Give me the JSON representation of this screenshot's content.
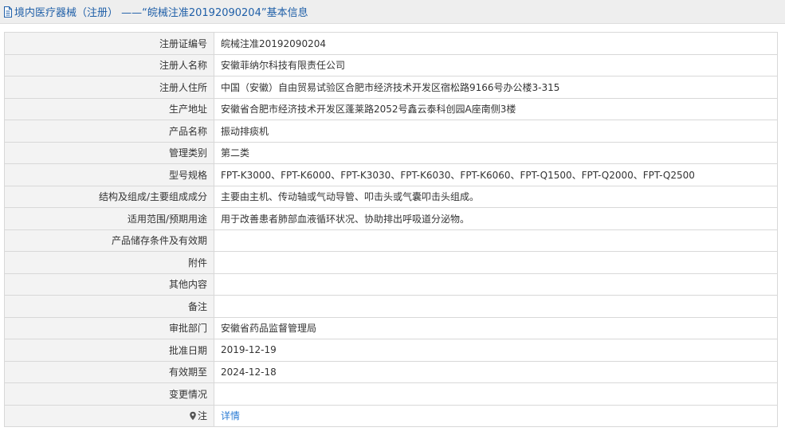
{
  "header": {
    "title": "境内医疗器械（注册） ——“皖械注准20192090204”基本信息",
    "doc_icon": "document-icon"
  },
  "rows": [
    {
      "label": "注册证编号",
      "value": "皖械注准20192090204"
    },
    {
      "label": "注册人名称",
      "value": "安徽菲纳尔科技有限责任公司"
    },
    {
      "label": "注册人住所",
      "value": "中国（安徽）自由贸易试验区合肥市经济技术开发区宿松路9166号办公楼3-315"
    },
    {
      "label": "生产地址",
      "value": "安徽省合肥市经济技术开发区蓬莱路2052号鑫云泰科创园A座南侧3楼"
    },
    {
      "label": "产品名称",
      "value": "振动排痰机"
    },
    {
      "label": "管理类别",
      "value": "第二类"
    },
    {
      "label": "型号规格",
      "value": "FPT-K3000、FPT-K6000、FPT-K3030、FPT-K6030、FPT-K6060、FPT-Q1500、FPT-Q2000、FPT-Q2500"
    },
    {
      "label": "结构及组成/主要组成成分",
      "value": "主要由主机、传动轴或气动导管、叩击头或气囊叩击头组成。"
    },
    {
      "label": "适用范围/预期用途",
      "value": "用于改善患者肺部血液循环状况、协助排出呼吸道分泌物。"
    },
    {
      "label": "产品储存条件及有效期",
      "value": ""
    },
    {
      "label": "附件",
      "value": ""
    },
    {
      "label": "其他内容",
      "value": ""
    },
    {
      "label": "备注",
      "value": ""
    },
    {
      "label": "审批部门",
      "value": "安徽省药品监督管理局"
    },
    {
      "label": "批准日期",
      "value": "2019-12-19"
    },
    {
      "label": "有效期至",
      "value": "2024-12-18"
    },
    {
      "label": "变更情况",
      "value": ""
    }
  ],
  "note": {
    "label": "注",
    "icon": "pin-icon",
    "link": "详情"
  },
  "colors": {
    "header_bg": "#eeeeee",
    "title_color": "#1f5fa8",
    "label_bg": "#f3f3f3",
    "border": "#d8d8d8",
    "link": "#2a7bd4"
  }
}
